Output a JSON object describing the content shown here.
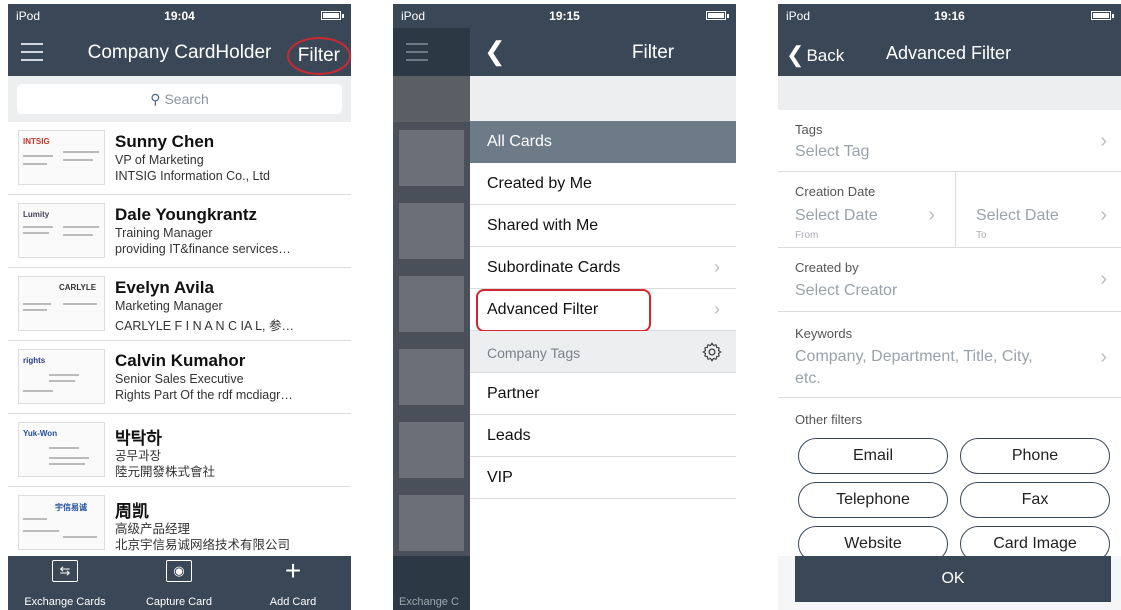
{
  "status": {
    "carrier": "iPod",
    "times": [
      "19:04",
      "19:15",
      "19:16"
    ]
  },
  "panel1": {
    "title": "Company CardHolder",
    "filter_label": "Filter",
    "search_placeholder": "Search",
    "cards": [
      {
        "name": "Sunny Chen",
        "title": "VP of Marketing",
        "company": "INTSIG Information Co., Ltd",
        "logo": "INTSIG"
      },
      {
        "name": "Dale Youngkrantz",
        "title": "Training Manager",
        "company": "providing IT&finance services…",
        "logo": "Lumity"
      },
      {
        "name": "Evelyn Avila",
        "title": "Marketing Manager",
        "company": "CARLYLE F I N A N C IA L, 参…",
        "logo": "CARLYLE"
      },
      {
        "name": "Calvin Kumahor",
        "title": "Senior Sales Executive",
        "company": "Rights Part Of the rdf mcdiagr…",
        "logo": "rights"
      },
      {
        "name": "박탁하",
        "title": "공무과장",
        "company": "陸元開發株式會社",
        "logo": "Yuk-Won"
      },
      {
        "name": "周凯",
        "title": "高级产品经理",
        "company": "北京宇信易诚网络技术有限公司",
        "logo": "宇信易诚"
      }
    ],
    "tabs": [
      {
        "label": "Exchange Cards",
        "icon": "exchange-icon"
      },
      {
        "label": "Capture Card",
        "icon": "camera-icon"
      },
      {
        "label": "Add Card",
        "icon": "plus-icon"
      }
    ]
  },
  "panel2": {
    "title": "Filter",
    "menu": [
      {
        "label": "All Cards"
      },
      {
        "label": "Created by Me"
      },
      {
        "label": "Shared with Me"
      },
      {
        "label": "Subordinate Cards"
      },
      {
        "label": "Advanced Filter"
      }
    ],
    "section_label": "Company Tags",
    "tags": [
      "Partner",
      "Leads",
      "VIP"
    ],
    "dim_tab_label": "Exchange C"
  },
  "panel3": {
    "back_label": "Back",
    "title": "Advanced Filter",
    "tags": {
      "label": "Tags",
      "value": "Select Tag"
    },
    "creation_date": {
      "label": "Creation Date",
      "from_value": "Select Date",
      "from_hint": "From",
      "to_value": "Select Date",
      "to_hint": "To"
    },
    "created_by": {
      "label": "Created by",
      "value": "Select Creator"
    },
    "keywords": {
      "label": "Keywords",
      "value_line1": "Company, Department, Title, City,",
      "value_line2": "etc."
    },
    "other_label": "Other filters",
    "pills": [
      "Email",
      "Phone",
      "Telephone",
      "Fax",
      "Website",
      "Card Image"
    ],
    "ok_label": "OK"
  },
  "colors": {
    "navbar": "#3a4757",
    "highlight": "#d0282f",
    "selected_row": "#6d7a88"
  }
}
